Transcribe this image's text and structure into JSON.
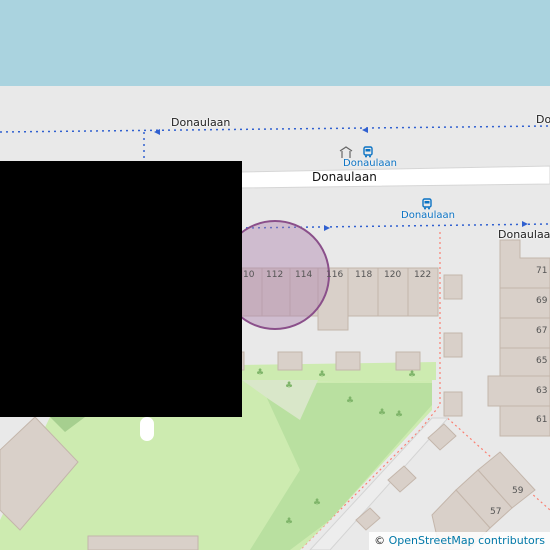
{
  "map": {
    "colors": {
      "water": "#aad3df",
      "land": "#e9e9e9",
      "road": "#ffffff",
      "building": "#d9d0c9",
      "building_outline": "#c4b6ab",
      "park": "#cdebb0",
      "grass": "#b5dca0",
      "path_dotted": "#fa8072",
      "route_blue": "#3060d0",
      "highlight_fill": "#b084b0",
      "highlight_stroke": "#8a4f8a",
      "overlay": "#000000"
    },
    "streets": {
      "donaulaan_top_left": "Donaulaan",
      "donaulaan_top_right": "Do",
      "donaulaan_main": "Donaulaan",
      "donaulaan_right": "Donaulaan"
    },
    "bus_stops": {
      "stop_upper": "Donaulaan",
      "stop_lower": "Donaulaan"
    },
    "house_numbers": {
      "row_top": [
        "10",
        "112",
        "114",
        "116",
        "118",
        "120",
        "122"
      ],
      "column_right": [
        "71",
        "69",
        "67",
        "65",
        "63",
        "61"
      ],
      "lower_right": [
        "59",
        "57"
      ]
    },
    "icons": [
      "bus-stop-icon",
      "shelter-icon",
      "tree-icon"
    ],
    "attribution": {
      "symbol": "©",
      "text": "OpenStreetMap contributors"
    }
  }
}
